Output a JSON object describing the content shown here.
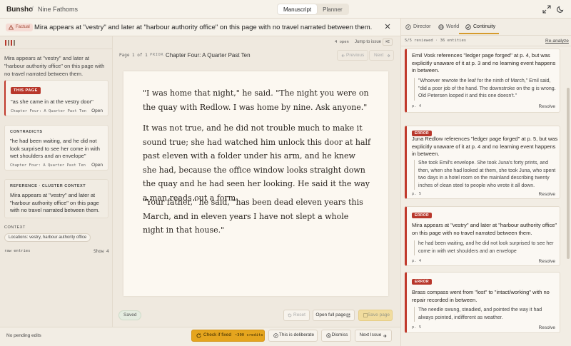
{
  "app": {
    "name": "Bunsho",
    "breadcrumb_sep": "/",
    "project": "Nine Fathoms"
  },
  "view_tabs": [
    {
      "label": "Manuscript",
      "active": true
    },
    {
      "label": "Planner",
      "active": false
    }
  ],
  "issue": {
    "category": "Factual",
    "title": "Mira appears at \"vestry\" and later at \"harbour authority office\" on this page with no travel narrated between them.",
    "open_count": "4 open",
    "jump_label": "Jump to issue",
    "jump_key": "⌘E"
  },
  "left": {
    "description": "Mira appears at \"vestry\" and later at \"harbour authority office\" on this page with no travel narrated between them.",
    "this_page": {
      "tag": "THIS PAGE",
      "quote": "\"as she came in at the vestry door\"",
      "location": "Chapter Four: A Quarter Past Ten",
      "open": "Open"
    },
    "contradicts": {
      "tag": "CONTRADICTS",
      "quote": "\"he had been waiting, and he did not look surprised to see her come in with wet shoulders and an envelope\"",
      "location": "Chapter Four: A Quarter Past Ten",
      "open": "Open"
    },
    "reference": {
      "tag": "REFERENCE · CLUSTER CONTEXT",
      "quote": "Mira appears at \"vestry\" and later at \"harbour authority office\" on this page with no travel narrated between them."
    },
    "context_label": "CONTEXT",
    "context_chip": "Locations: vestry, harbour authority office",
    "raw_label": "raw entries",
    "raw_show": "Show 4",
    "pending": "No pending edits"
  },
  "manuscript": {
    "page_label": "Page 1 of 1",
    "prior_label": "PRIOR",
    "chapter": "Chapter Four: A Quarter Past Ten",
    "prev": "Previous",
    "next": "Next",
    "paragraphs": [
      "\"I was home that night,\" he said. \"The night you were on the quay with Redlow. I was home by nine. Ask anyone.\"",
      "It was not true, and he did not trouble much to make it sound true; she had watched him unlock this door at half past eleven with a folder under his arm, and he knew she had, because the office window looks straight down the quay and he had seen her looking. He said it the way a man reads out a form.",
      "\"Your father,\" he said, \"has been dead eleven years this March, and in eleven years I have not slept a whole night in that house.\""
    ],
    "saved": "Saved",
    "reset": "Reset",
    "open_full": "Open full page",
    "save_page": "Save page"
  },
  "actions": {
    "check": "Check if fixed",
    "credits": "~300 credits",
    "deliberate": "This is deliberate",
    "dismiss": "Dismiss",
    "next_issue": "Next Issue"
  },
  "right": {
    "tabs": [
      {
        "label": "Director",
        "icon": "compass-icon"
      },
      {
        "label": "World",
        "icon": "globe-icon"
      },
      {
        "label": "Continuity",
        "icon": "check-circle-icon",
        "active": true
      }
    ],
    "reviewed": "5/5 reviewed · 36 entities",
    "reanalyze": "Re-analyze",
    "issues": [
      {
        "title": "Emil Vosk references \"ledger page forged\" at p. 4, but was explicitly unaware of it at p. 3 and no learning event happens in between.",
        "quote": "\"Whoever rewrote the leaf for the ninth of March,\" Emil said, \"did a poor job of the hand. The downstroke on the g is wrong. Old Petersen looped it and this one doesn't.\"",
        "page": "p. 4",
        "resolve": "Resolve"
      },
      {
        "tag": "ERROR",
        "title": "Juna Redlow references \"ledger page forged\" at p. 5, but was explicitly unaware of it at p. 4 and no learning event happens in between.",
        "quote": "She took Emil's envelope. She took Juna's forty prints, and then, when she had looked at them, she took Juna, who spent two days in a hotel room on the mainland describing twenty inches of clean steel to people who wrote it all down.",
        "page": "p. 5",
        "resolve": "Resolve"
      },
      {
        "tag": "ERROR",
        "title": "Mira appears at \"vestry\" and later at \"harbour authority office\" on this page with no travel narrated between them.",
        "quote": "he had been waiting, and he did not look surprised to see her come in with wet shoulders and an envelope",
        "page": "p. 4",
        "resolve": "Resolve"
      },
      {
        "tag": "ERROR",
        "title": "Brass compass went from \"lost\" to \"intact/working\" with no repair recorded in between.",
        "quote": "The needle swung, steadied, and pointed the way it had always pointed, indifferent as weather.",
        "page": "p. 5",
        "resolve": "Resolve"
      }
    ]
  },
  "colors": {
    "accent": "#e5a51e",
    "error": "#b8372b",
    "paper": "#fcf8f1",
    "tab_underline": "#d69b2d"
  }
}
